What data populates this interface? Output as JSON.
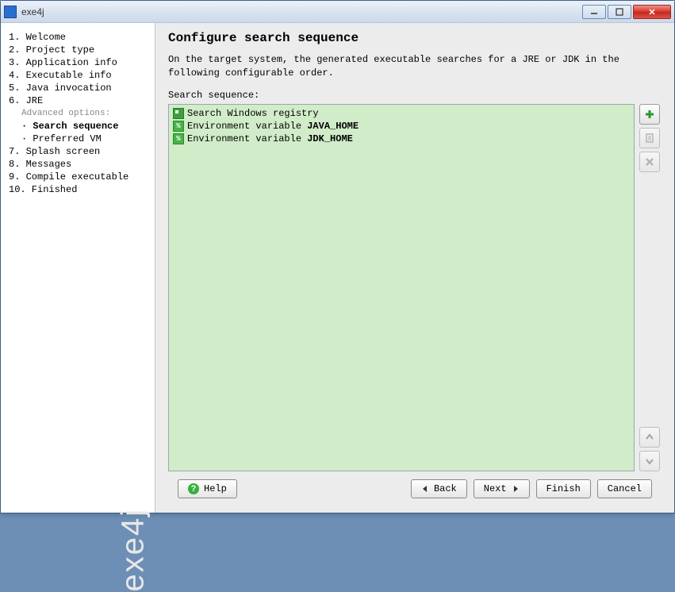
{
  "window": {
    "title": "exe4j",
    "watermark": "exe4j"
  },
  "sidebar": {
    "steps": [
      {
        "num": "1.",
        "label": "Welcome"
      },
      {
        "num": "2.",
        "label": "Project type"
      },
      {
        "num": "3.",
        "label": "Application info"
      },
      {
        "num": "4.",
        "label": "Executable info"
      },
      {
        "num": "5.",
        "label": "Java invocation"
      },
      {
        "num": "6.",
        "label": "JRE"
      }
    ],
    "advanced_label": "Advanced options:",
    "substeps": [
      {
        "label": "Search sequence",
        "active": true
      },
      {
        "label": "Preferred VM",
        "active": false
      }
    ],
    "steps_after": [
      {
        "num": "7.",
        "label": "Splash screen"
      },
      {
        "num": "8.",
        "label": "Messages"
      },
      {
        "num": "9.",
        "label": "Compile executable"
      },
      {
        "num": "10.",
        "label": "Finished"
      }
    ]
  },
  "main": {
    "title": "Configure search sequence",
    "description": "On the target system, the generated executable searches for a JRE or JDK in the following configurable order.",
    "seq_label": "Search sequence:",
    "items": [
      {
        "type": "registry",
        "prefix": "Search Windows registry",
        "bold": ""
      },
      {
        "type": "env",
        "prefix": "Environment variable ",
        "bold": "JAVA_HOME"
      },
      {
        "type": "env",
        "prefix": "Environment variable ",
        "bold": "JDK_HOME"
      }
    ]
  },
  "tools": {
    "add": "add",
    "edit": "edit",
    "remove": "remove",
    "up": "up",
    "down": "down"
  },
  "footer": {
    "help": "Help",
    "back": "Back",
    "next": "Next",
    "finish": "Finish",
    "cancel": "Cancel"
  }
}
